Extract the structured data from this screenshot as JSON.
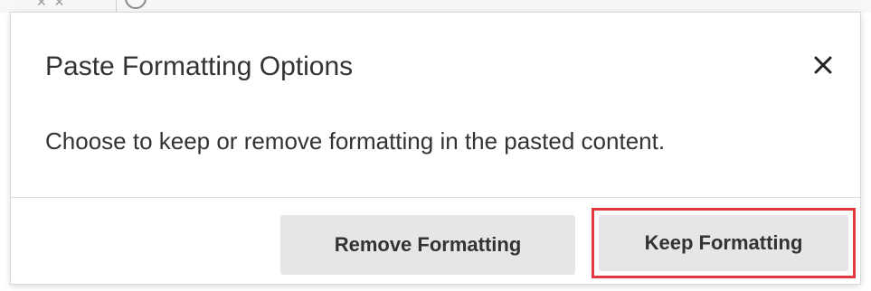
{
  "dialog": {
    "title": "Paste Formatting Options",
    "message": "Choose to keep or remove formatting in the pasted content.",
    "close_icon": "close-icon"
  },
  "buttons": {
    "remove_label": "Remove Formatting",
    "keep_label": "Keep Formatting"
  },
  "colors": {
    "highlight": "#e0383e",
    "button_bg": "#e6e6e6",
    "text": "#333333"
  }
}
